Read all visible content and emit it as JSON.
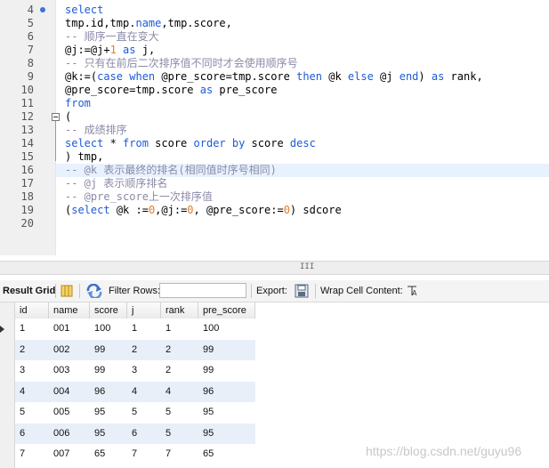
{
  "editor": {
    "line_numbers": [
      "4",
      "5",
      "6",
      "7",
      "8",
      "9",
      "10",
      "11",
      "12",
      "13",
      "14",
      "15",
      "16",
      "17",
      "18",
      "19",
      "20"
    ],
    "lines": [
      [
        {
          "t": "select",
          "c": "kw"
        }
      ],
      [
        {
          "t": "tmp.id,tmp.",
          "c": ""
        },
        {
          "t": "name",
          "c": "kw"
        },
        {
          "t": ",tmp.score,",
          "c": ""
        }
      ],
      [
        {
          "t": "-- 顺序一直在变大",
          "c": "cm"
        }
      ],
      [
        {
          "t": "@j:=@j+",
          "c": ""
        },
        {
          "t": "1",
          "c": "nm"
        },
        {
          "t": " as ",
          "c": "kw"
        },
        {
          "t": "j,",
          "c": ""
        }
      ],
      [
        {
          "t": "-- 只有在前后二次排序值不同时才会使用顺序号",
          "c": "cm"
        }
      ],
      [
        {
          "t": "@k:=(",
          "c": ""
        },
        {
          "t": "case when ",
          "c": "kw"
        },
        {
          "t": "@pre_score=tmp.score ",
          "c": ""
        },
        {
          "t": "then ",
          "c": "kw"
        },
        {
          "t": "@k ",
          "c": ""
        },
        {
          "t": "else ",
          "c": "kw"
        },
        {
          "t": "@j ",
          "c": ""
        },
        {
          "t": "end",
          "c": "kw"
        },
        {
          "t": ") ",
          "c": ""
        },
        {
          "t": "as ",
          "c": "kw"
        },
        {
          "t": "rank,",
          "c": ""
        }
      ],
      [
        {
          "t": "@pre_score=tmp.score ",
          "c": ""
        },
        {
          "t": "as ",
          "c": "kw"
        },
        {
          "t": "pre_score",
          "c": ""
        }
      ],
      [
        {
          "t": "from",
          "c": "kw"
        }
      ],
      [
        {
          "t": "(",
          "c": ""
        }
      ],
      [
        {
          "t": "-- 成绩排序",
          "c": "cm"
        }
      ],
      [
        {
          "t": "select ",
          "c": "kw"
        },
        {
          "t": "* ",
          "c": ""
        },
        {
          "t": "from ",
          "c": "kw"
        },
        {
          "t": "score ",
          "c": ""
        },
        {
          "t": "order by ",
          "c": "kw"
        },
        {
          "t": "score ",
          "c": ""
        },
        {
          "t": "desc",
          "c": "kw"
        }
      ],
      [
        {
          "t": ") tmp,",
          "c": ""
        }
      ],
      [
        {
          "t": "-- @k 表示最终的排名(相同值时序号相同)",
          "c": "cm"
        }
      ],
      [
        {
          "t": "-- @j 表示顺序排名",
          "c": "cm"
        }
      ],
      [
        {
          "t": "-- @pre_score上一次排序值",
          "c": "cm"
        }
      ],
      [
        {
          "t": "(",
          "c": ""
        },
        {
          "t": "select ",
          "c": "kw"
        },
        {
          "t": "@k :=",
          "c": ""
        },
        {
          "t": "0",
          "c": "nm"
        },
        {
          "t": ",@j:=",
          "c": ""
        },
        {
          "t": "0",
          "c": "nm"
        },
        {
          "t": ", @pre_score:=",
          "c": ""
        },
        {
          "t": "0",
          "c": "nm"
        },
        {
          "t": ") sdcore",
          "c": ""
        }
      ],
      []
    ],
    "hscroll_grip": "III"
  },
  "toolbar": {
    "result_grid_label": "Result Grid",
    "filter_rows_label": "Filter Rows:",
    "filter_value": "",
    "export_label": "Export:",
    "wrap_label": "Wrap Cell Content:"
  },
  "grid": {
    "columns": [
      "id",
      "name",
      "score",
      "j",
      "rank",
      "pre_score"
    ],
    "rows": [
      [
        "1",
        "001",
        "100",
        "1",
        "1",
        "100"
      ],
      [
        "2",
        "002",
        "99",
        "2",
        "2",
        "99"
      ],
      [
        "3",
        "003",
        "99",
        "3",
        "2",
        "99"
      ],
      [
        "4",
        "004",
        "96",
        "4",
        "4",
        "96"
      ],
      [
        "5",
        "005",
        "95",
        "5",
        "5",
        "95"
      ],
      [
        "6",
        "006",
        "95",
        "6",
        "5",
        "95"
      ],
      [
        "7",
        "007",
        "65",
        "7",
        "7",
        "65"
      ]
    ]
  },
  "watermark": "https://blog.csdn.net/guyu96",
  "colors": {
    "keyword": "#1c5bd8",
    "comment": "#8a8aa8",
    "number": "#e57b2b",
    "current_line": "#e8f2fe",
    "alt_row": "#e9eff8"
  }
}
